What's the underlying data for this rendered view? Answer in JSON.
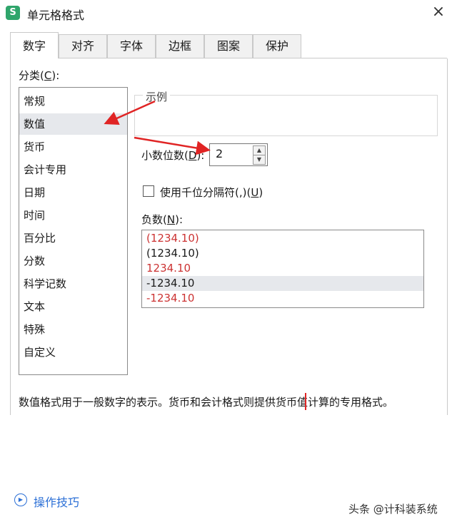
{
  "window": {
    "app_icon": "S",
    "title": "单元格格式",
    "close_icon": "×"
  },
  "tabs": [
    {
      "label": "数字"
    },
    {
      "label": "对齐"
    },
    {
      "label": "字体"
    },
    {
      "label": "边框"
    },
    {
      "label": "图案"
    },
    {
      "label": "保护"
    }
  ],
  "category": {
    "label": "分类",
    "hotkey": "C",
    "items": [
      "常规",
      "数值",
      "货币",
      "会计专用",
      "日期",
      "时间",
      "百分比",
      "分数",
      "科学记数",
      "文本",
      "特殊",
      "自定义"
    ],
    "selected": "数值"
  },
  "sample": {
    "label": "示例"
  },
  "decimal_places": {
    "label": "小数位数",
    "hotkey": "D",
    "value": "2"
  },
  "thousands_sep": {
    "label": "使用千位分隔符(,)",
    "hotkey": "U",
    "checked": false
  },
  "negative": {
    "label": "负数",
    "hotkey": "N",
    "items": [
      {
        "text": "(1234.10)",
        "color": "#cc3333"
      },
      {
        "text": "(1234.10)",
        "color": "#1a1a1a"
      },
      {
        "text": "1234.10",
        "color": "#cc3333"
      },
      {
        "text": "-1234.10",
        "color": "#1a1a1a"
      },
      {
        "text": "-1234.10",
        "color": "#cc3333"
      }
    ],
    "selected": "-1234.10"
  },
  "description": "数值格式用于一般数字的表示。货币和会计格式则提供货币值计算的专用格式。",
  "footer": {
    "tips_label": "操作技巧",
    "watermark": "头条 @计科装系统"
  },
  "colors": {
    "accent": "#2b6fd6",
    "arrow": "#e02424",
    "logo": "#2fa56b"
  }
}
